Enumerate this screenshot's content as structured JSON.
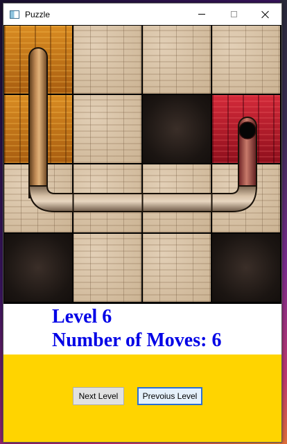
{
  "window": {
    "title": "Puzzle",
    "controls": [
      "minimize-icon",
      "maximize-icon",
      "close-icon"
    ]
  },
  "board": {
    "rows": 4,
    "cols": 4,
    "tiles": [
      [
        "start-vertical",
        "stone",
        "stone",
        "stone"
      ],
      [
        "pipe-vertical",
        "stone",
        "blank",
        "goal"
      ],
      [
        "pipe-corner-top-right",
        "pipe-horizontal",
        "pipe-horizontal",
        "pipe-corner-top-left"
      ],
      [
        "blank",
        "stone",
        "stone",
        "blank"
      ]
    ]
  },
  "status": {
    "level_label": "Level 6",
    "moves_label": "Number of Moves:",
    "moves_value": "6"
  },
  "buttons": {
    "next_label": "Next Level",
    "prev_label": "Prevoius Level"
  },
  "colors": {
    "status_text": "#0000e6",
    "panel": "#ffd400",
    "start_tile": "#c77a1a",
    "goal_tile": "#b0182a"
  }
}
